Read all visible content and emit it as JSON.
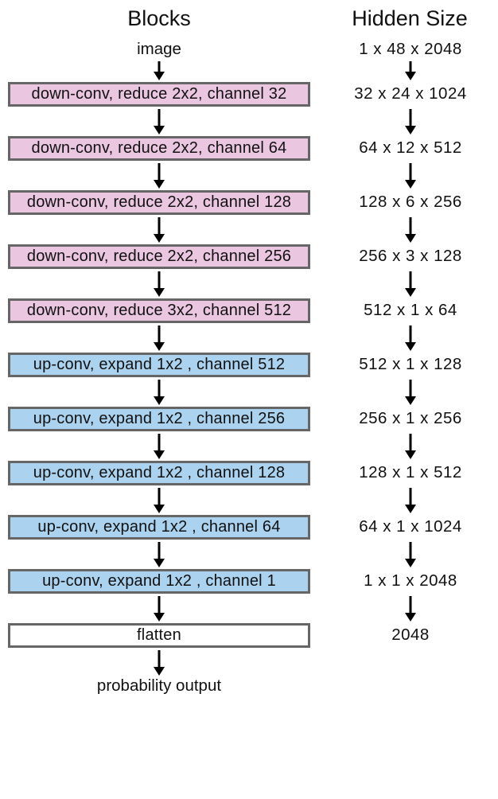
{
  "headers": {
    "left": "Blocks",
    "right": "Hidden Size"
  },
  "input": {
    "label": "image",
    "hidden": "1 x 48 x 2048"
  },
  "output": {
    "label": "probability output"
  },
  "blocks": [
    {
      "text": "down-conv, reduce 2x2, channel 32",
      "type": "pink",
      "hidden": "32 x 24 x 1024"
    },
    {
      "text": "down-conv, reduce 2x2, channel 64",
      "type": "pink",
      "hidden": "64 x 12 x 512"
    },
    {
      "text": "down-conv, reduce 2x2, channel 128",
      "type": "pink",
      "hidden": "128 x 6 x 256"
    },
    {
      "text": "down-conv, reduce 2x2, channel 256",
      "type": "pink",
      "hidden": "256 x 3 x 128"
    },
    {
      "text": "down-conv, reduce 3x2, channel 512",
      "type": "pink",
      "hidden": "512 x 1 x 64"
    },
    {
      "text": "up-conv, expand 1x2 ,   channel 512",
      "type": "blue",
      "hidden": "512 x 1 x 128"
    },
    {
      "text": "up-conv, expand 1x2 ,   channel 256",
      "type": "blue",
      "hidden": "256 x 1 x 256"
    },
    {
      "text": "up-conv, expand 1x2 ,   channel 128",
      "type": "blue",
      "hidden": "128 x 1 x 512"
    },
    {
      "text": "up-conv, expand 1x2 ,   channel 64",
      "type": "blue",
      "hidden": "64 x 1 x 1024"
    },
    {
      "text": "up-conv, expand 1x2 ,   channel 1",
      "type": "blue",
      "hidden": "1 x 1 x 2048"
    },
    {
      "text": "flatten",
      "type": "white",
      "hidden": "2048"
    }
  ]
}
